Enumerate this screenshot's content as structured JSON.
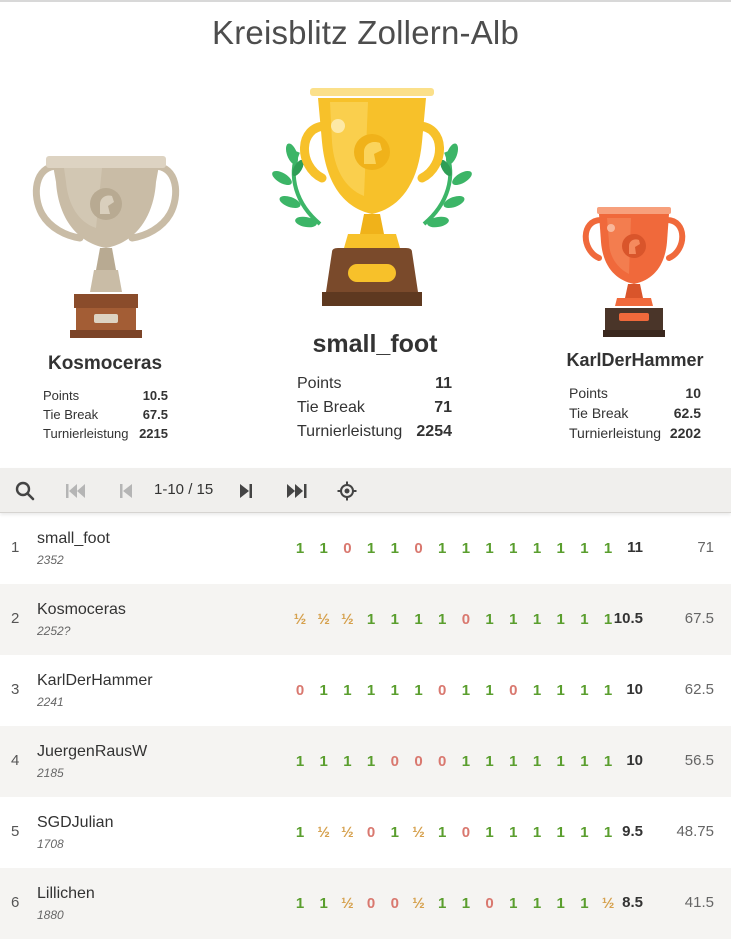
{
  "title": "Kreisblitz Zollern-Alb",
  "podium": {
    "first": {
      "name": "small_foot",
      "points_label": "Points",
      "points": "11",
      "tiebreak_label": "Tie Break",
      "tiebreak": "71",
      "perf_label": "Turnierleistung",
      "perf": "2254"
    },
    "second": {
      "name": "Kosmoceras",
      "points_label": "Points",
      "points": "10.5",
      "tiebreak_label": "Tie Break",
      "tiebreak": "67.5",
      "perf_label": "Turnierleistung",
      "perf": "2215"
    },
    "third": {
      "name": "KarlDerHammer",
      "points_label": "Points",
      "points": "10",
      "tiebreak_label": "Tie Break",
      "tiebreak": "62.5",
      "perf_label": "Turnierleistung",
      "perf": "2202"
    }
  },
  "toolbar": {
    "page_indicator": "1-10 / 15",
    "icons": [
      "search-icon",
      "first-page-icon",
      "previous-page-icon",
      "next-page-icon",
      "last-page-icon",
      "locate-icon"
    ]
  },
  "colors": {
    "win": "#5a9e2e",
    "loss": "#d9786f",
    "draw": "#d6a14e",
    "gold": "#f7c12a",
    "silver": "#c9bca6",
    "bronze": "#f0693b"
  },
  "standings": [
    {
      "rank": "1",
      "name": "small_foot",
      "rating": "2352",
      "results": [
        "1",
        "1",
        "0",
        "1",
        "1",
        "0",
        "1",
        "1",
        "1",
        "1",
        "1",
        "1",
        "1",
        "1"
      ],
      "score": "11",
      "tiebreak": "71"
    },
    {
      "rank": "2",
      "name": "Kosmoceras",
      "rating": "2252?",
      "results": [
        "½",
        "½",
        "½",
        "1",
        "1",
        "1",
        "1",
        "0",
        "1",
        "1",
        "1",
        "1",
        "1",
        "1"
      ],
      "score": "10.5",
      "tiebreak": "67.5"
    },
    {
      "rank": "3",
      "name": "KarlDerHammer",
      "rating": "2241",
      "results": [
        "0",
        "1",
        "1",
        "1",
        "1",
        "1",
        "0",
        "1",
        "1",
        "0",
        "1",
        "1",
        "1",
        "1"
      ],
      "score": "10",
      "tiebreak": "62.5"
    },
    {
      "rank": "4",
      "name": "JuergenRausW",
      "rating": "2185",
      "results": [
        "1",
        "1",
        "1",
        "1",
        "0",
        "0",
        "0",
        "1",
        "1",
        "1",
        "1",
        "1",
        "1",
        "1"
      ],
      "score": "10",
      "tiebreak": "56.5"
    },
    {
      "rank": "5",
      "name": "SGDJulian",
      "rating": "1708",
      "results": [
        "1",
        "½",
        "½",
        "0",
        "1",
        "½",
        "1",
        "0",
        "1",
        "1",
        "1",
        "1",
        "1",
        "1"
      ],
      "score": "9.5",
      "tiebreak": "48.75"
    },
    {
      "rank": "6",
      "name": "Lillichen",
      "rating": "1880",
      "results": [
        "1",
        "1",
        "½",
        "0",
        "0",
        "½",
        "1",
        "1",
        "0",
        "1",
        "1",
        "1",
        "1",
        "½"
      ],
      "score": "8.5",
      "tiebreak": "41.5"
    }
  ]
}
